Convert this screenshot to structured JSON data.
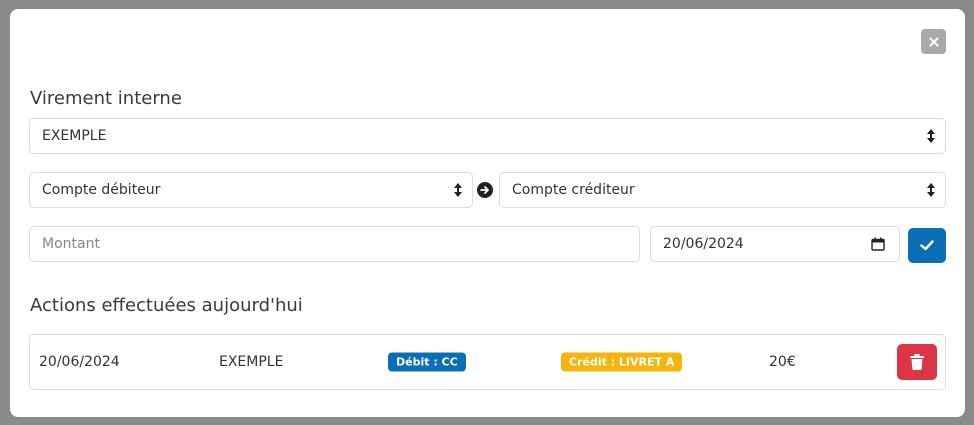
{
  "modal": {
    "close_icon": "close-icon"
  },
  "transfer": {
    "title": "Virement interne",
    "account_select": {
      "value": "EXEMPLE"
    },
    "debit_select": {
      "value": "Compte débiteur"
    },
    "credit_select": {
      "value": "Compte créditeur"
    },
    "amount_input": {
      "placeholder": "Montant",
      "value": ""
    },
    "date_input": {
      "value": "20/06/2024"
    },
    "confirm_icon": "check-icon"
  },
  "actions": {
    "title": "Actions effectuées aujourd'hui",
    "rows": [
      {
        "date": "20/06/2024",
        "name": "EXEMPLE",
        "debit_badge": "Débit : CC",
        "credit_badge": "Crédit : LIVRET A",
        "amount": "20€",
        "delete_icon": "trash-icon"
      }
    ]
  },
  "colors": {
    "primary": "#0a6fb5",
    "warning": "#f6b40e",
    "danger": "#dc3545",
    "close_bg": "#a9a9a9",
    "overlay": "#8a8a8a"
  }
}
